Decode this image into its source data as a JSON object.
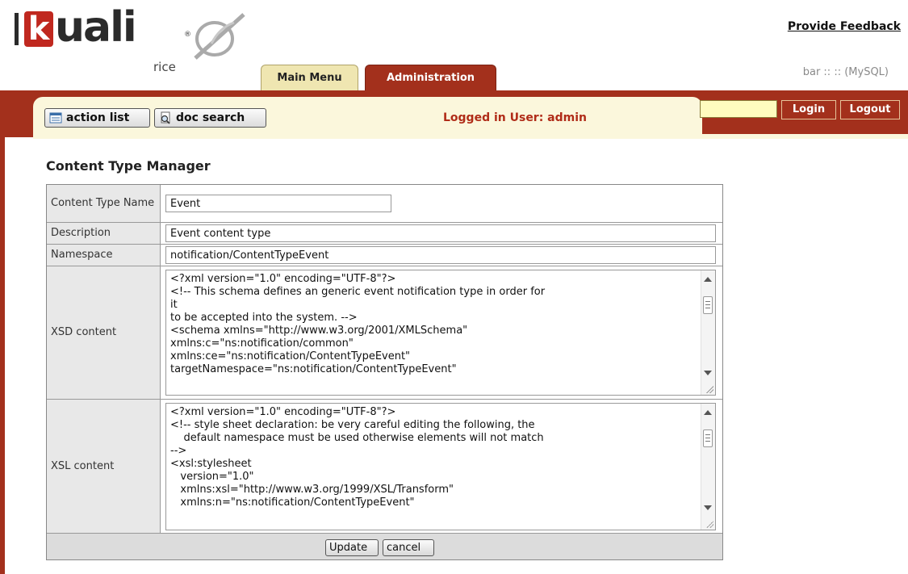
{
  "header": {
    "logo_letter": "k",
    "logo_word": "uali",
    "logo_reg": "®",
    "logo_sub": "rice",
    "feedback_link": "Provide Feedback",
    "db_info": "bar :: :: (MySQL)",
    "tabs": [
      {
        "label": "Main Menu"
      },
      {
        "label": "Administration"
      }
    ]
  },
  "toolbar": {
    "action_list": "action list",
    "doc_search": "doc search",
    "logged_in": "Logged in User: admin",
    "login_value": "",
    "login_button": "Login",
    "logout_button": "Logout"
  },
  "form": {
    "title": "Content Type Manager",
    "rows": {
      "name": {
        "label": "Content Type Name",
        "value": "Event"
      },
      "description": {
        "label": "Description",
        "value": "Event content type"
      },
      "namespace": {
        "label": "Namespace",
        "value": "notification/ContentTypeEvent"
      },
      "xsd": {
        "label": "XSD content",
        "lines": [
          "<?xml version=\"1.0\" encoding=\"UTF-8\"?>",
          "<!-- This schema defines an generic event notification type in order for",
          "it",
          "to be accepted into the system. -->",
          "<schema xmlns=\"http://www.w3.org/2001/XMLSchema\"",
          "xmlns:c=\"ns:notification/common\"",
          "xmlns:ce=\"ns:notification/ContentTypeEvent\"",
          "targetNamespace=\"ns:notification/ContentTypeEvent\""
        ]
      },
      "xsl": {
        "label": "XSL content",
        "lines": [
          "<?xml version=\"1.0\" encoding=\"UTF-8\"?>",
          "<!-- style sheet declaration: be very careful editing the following, the",
          "    default namespace must be used otherwise elements will not match",
          "-->",
          "<xsl:stylesheet",
          "   version=\"1.0\"",
          "   xmlns:xsl=\"http://www.w3.org/1999/XSL/Transform\"",
          "   xmlns:n=\"ns:notification/ContentTypeEvent\""
        ]
      }
    },
    "update_button": "Update",
    "cancel_button": "cancel"
  },
  "colors": {
    "brand_red": "#a3301c",
    "cream": "#fbf7dc",
    "tab_inactive": "#efe6b1",
    "logged_user_text": "#b02c18"
  },
  "icons": {
    "logo_mark": "kuali-rice-mark-icon",
    "action_list": "action-list-icon",
    "doc_search": "doc-search-icon"
  }
}
